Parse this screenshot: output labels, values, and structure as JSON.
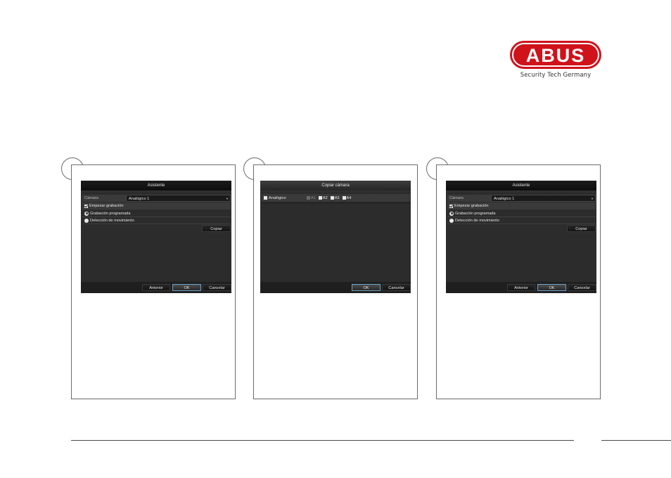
{
  "brand": {
    "logo_text": "ABUS",
    "tagline": "Security Tech Germany",
    "red": "#d0121b"
  },
  "panel1": {
    "title": "Asistente",
    "camera_label": "Cámara",
    "camera_value": "Analógico 1",
    "start_recording": "Empezar grabación",
    "scheduled": "Grabación programada",
    "motion": "Detección de movimiento",
    "copy_button": "Copiar",
    "prev_button": "Anterior",
    "ok_button": "OK",
    "cancel_button": "Cancelar"
  },
  "panel2": {
    "title": "Copiar cámara",
    "analog_label": "Analógico",
    "cameras": [
      "A1",
      "A2",
      "A3",
      "A4"
    ],
    "ok_button": "OK",
    "cancel_button": "Cancelar"
  },
  "panel3": {
    "title": "Asistente",
    "camera_label": "Cámara",
    "camera_value": "Analógico 1",
    "start_recording": "Empezar grabación",
    "scheduled": "Grabación programada",
    "motion": "Detección de movimiento",
    "copy_button": "Copiar",
    "prev_button": "Anterior",
    "ok_button": "OK",
    "cancel_button": "Cancelar"
  }
}
